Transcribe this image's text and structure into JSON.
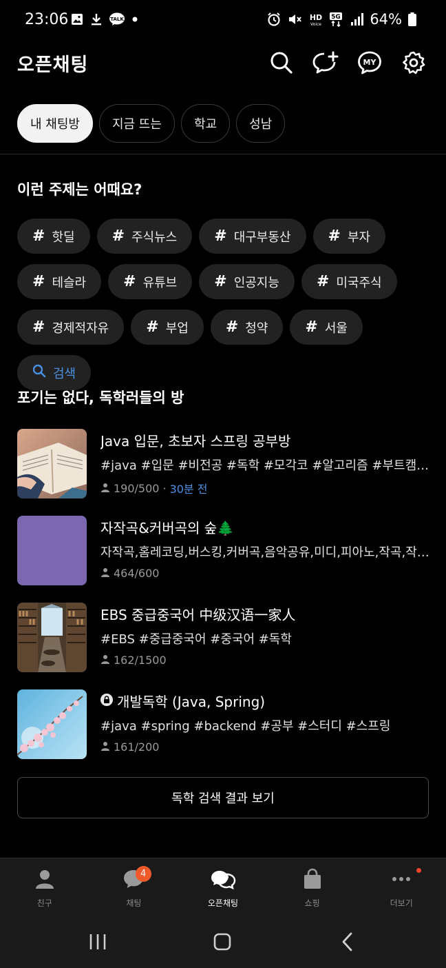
{
  "status_bar": {
    "time": "23:06",
    "left_icons": [
      "gallery-icon",
      "download-icon",
      "talk-icon",
      "dot-icon"
    ],
    "right_icons": [
      "alarm-icon",
      "mute-icon",
      "hd-voice-icon",
      "5g-icon",
      "signal-icon"
    ],
    "battery": "64%"
  },
  "header": {
    "title": "오픈채팅",
    "icons": [
      "search-icon",
      "new-chat-icon",
      "my-icon",
      "settings-icon"
    ]
  },
  "tabs": [
    {
      "label": "내 채팅방",
      "active": true
    },
    {
      "label": "지금 뜨는",
      "active": false
    },
    {
      "label": "학교",
      "active": false
    },
    {
      "label": "성남",
      "active": false
    }
  ],
  "topics": {
    "title": "이런 주제는 어때요?",
    "hash": "#",
    "items": [
      "핫딜",
      "주식뉴스",
      "대구부동산",
      "부자",
      "테슬라",
      "유튜브",
      "인공지능",
      "미국주식",
      "경제적자유",
      "부업",
      "청약",
      "서울"
    ],
    "search_label": "검색"
  },
  "rooms_section": {
    "title": "포기는 없다, 독학러들의 방",
    "rooms": [
      {
        "title": "Java 입문, 초보자 스프링 공부방",
        "tags": "#java #입문 #비전공 #독학 #모각코 #알고리즘 #부트캠프 #코딩",
        "members": "190/500",
        "separator": "·",
        "recent": "30분 전",
        "locked": false
      },
      {
        "title": "자작곡&커버곡의 숲🌲",
        "tags": "자작곡,홈레코딩,버스킹,커버곡,음악공유,미디,피아노,작곡,작사,기타",
        "members": "464/600",
        "recent": "",
        "locked": false
      },
      {
        "title": "EBS 중급중국어 中级汉语一家人",
        "tags": "#EBS #중급중국어 #중국어 #독학",
        "members": "162/1500",
        "recent": "",
        "locked": false
      },
      {
        "title": "개발독학 (Java, Spring)",
        "tags": "#java #spring #backend #공부 #스터디 #스프링",
        "members": "161/200",
        "recent": "",
        "locked": true
      }
    ],
    "see_all_label": "독학 검색 결과 보기"
  },
  "bottom_nav": [
    {
      "label": "친구",
      "icon": "person-icon",
      "active": false
    },
    {
      "label": "채팅",
      "icon": "chat-icon",
      "active": false,
      "badge": "4"
    },
    {
      "label": "오픈채팅",
      "icon": "open-chat-icon",
      "active": true
    },
    {
      "label": "쇼핑",
      "icon": "shopping-bag-icon",
      "active": false
    },
    {
      "label": "더보기",
      "icon": "more-icon",
      "active": false
    }
  ],
  "colors": {
    "accent_blue": "#4a90e2",
    "badge_orange": "#f05a2a",
    "thumb_purple": "#7b68b0"
  }
}
